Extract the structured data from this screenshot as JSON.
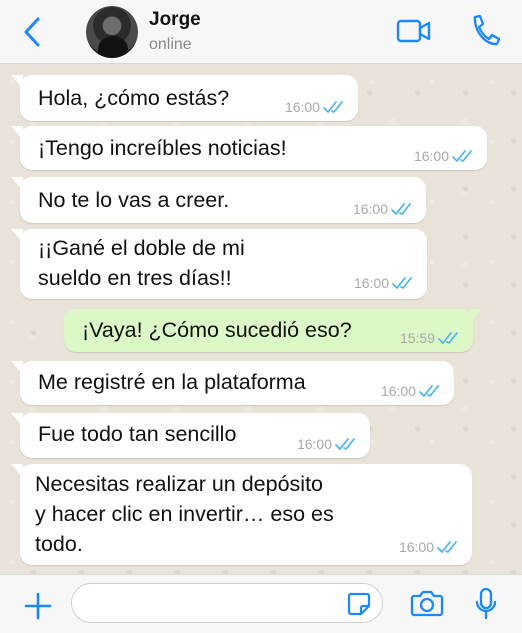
{
  "header": {
    "contact_name": "Jorge",
    "status": "online",
    "icons": [
      "back-chevron-icon",
      "video-call-icon",
      "phone-icon"
    ]
  },
  "colors": {
    "accent": "#1a88ff",
    "tick_read": "#4fb6ec",
    "incoming_bubble": "#ffffff",
    "outgoing_bubble": "#dcf8c6",
    "chat_background": "#e9e2d8"
  },
  "messages": [
    {
      "direction": "in",
      "lines": [
        "Hola, ¿cómo estás?"
      ],
      "time": "16:00",
      "status": "read"
    },
    {
      "direction": "in",
      "lines": [
        "¡Tengo increíbles noticias!"
      ],
      "time": "16:00",
      "status": "read"
    },
    {
      "direction": "in",
      "lines": [
        "No te lo vas a creer."
      ],
      "time": "16:00",
      "status": "read"
    },
    {
      "direction": "in",
      "lines": [
        "¡¡Gané el doble de mi",
        "sueldo en tres días!!"
      ],
      "time": "16:00",
      "status": "read"
    },
    {
      "direction": "out",
      "lines": [
        "¡Vaya! ¿Cómo sucedió eso?"
      ],
      "time": "15:59",
      "status": "read"
    },
    {
      "direction": "in",
      "lines": [
        "Me registré en la plataforma"
      ],
      "time": "16:00",
      "status": "read"
    },
    {
      "direction": "in",
      "lines": [
        "Fue todo tan sencillo"
      ],
      "time": "16:00",
      "status": "read"
    },
    {
      "direction": "in",
      "lines": [
        "Necesitas realizar un depósito",
        "y hacer clic en invertir… eso es",
        "todo."
      ],
      "time": "16:00",
      "status": "read"
    }
  ],
  "input_bar": {
    "value": "",
    "placeholder": "",
    "icons": [
      "plus-icon",
      "sticker-icon",
      "camera-icon",
      "microphone-icon"
    ]
  }
}
